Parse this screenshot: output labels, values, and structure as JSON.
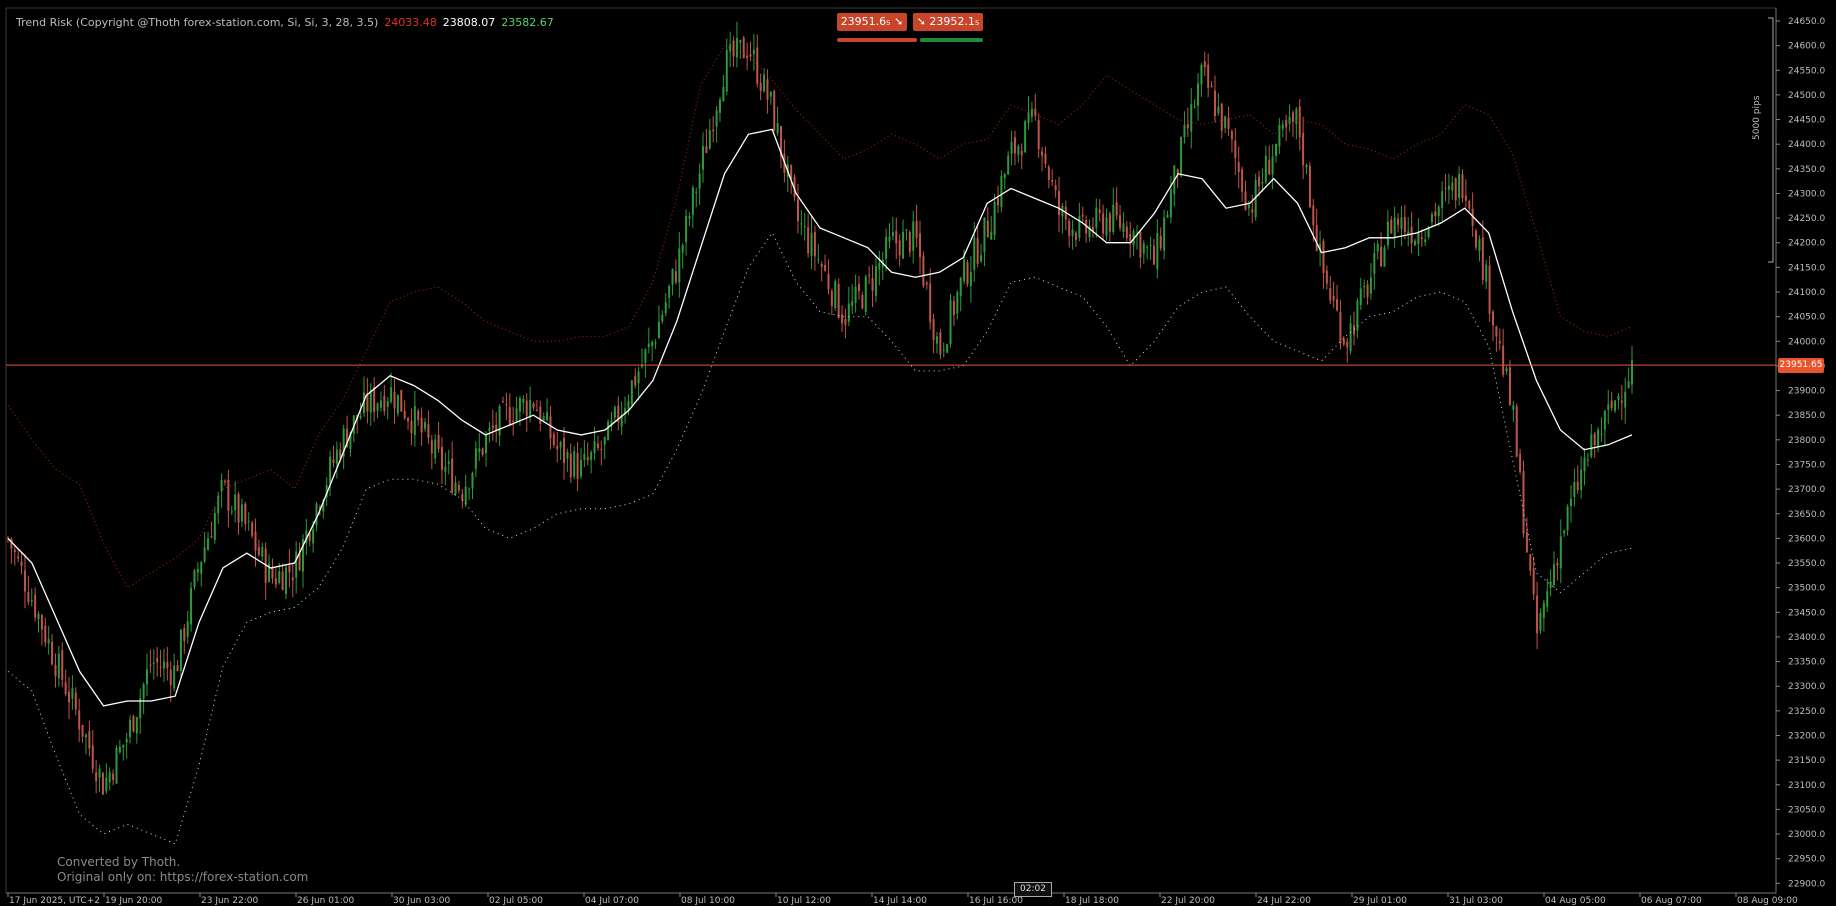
{
  "indicator": {
    "title": "Trend Risk (Copyright @Thoth forex-station.com, Si, Si, 3, 28, 3.5)",
    "value_upper": "24033.48",
    "value_mid": "23808.07",
    "value_lower": "23582.67"
  },
  "trade": {
    "sell_label": "23951.6₅  ➘",
    "buy_label": "➘  23952.1₅",
    "sell_color": "#c8452c",
    "buy_color": "#c8452c"
  },
  "watermark": {
    "line1": "Converted by Thoth.",
    "line2": "Original only on: https://forex-station.com"
  },
  "current_price_label": "23951.65",
  "pips_label": "5000 pips",
  "crosshair_time": "02:02",
  "colors": {
    "background": "#000000",
    "bull": "#2f9a3a",
    "bear": "#c0564a",
    "mid_line": "#ffffff",
    "upper_band": "#b02020",
    "lower_band": "#d8d8d8",
    "price_line": "#e8552c",
    "axis_text": "#bdbdbd"
  },
  "chart_data": {
    "type": "candlestick",
    "ylim": [
      22875,
      24690
    ],
    "current_price": 23951.65,
    "y_ticks": [
      "24650.0",
      "24600.0",
      "24550.0",
      "24500.0",
      "24450.0",
      "24400.0",
      "24350.0",
      "24300.0",
      "24250.0",
      "24200.0",
      "24150.0",
      "24100.0",
      "24050.0",
      "24000.0",
      "23950.0",
      "23900.0",
      "23850.0",
      "23800.0",
      "23750.0",
      "23700.0",
      "23650.0",
      "23600.0",
      "23550.0",
      "23500.0",
      "23450.0",
      "23400.0",
      "23350.0",
      "23300.0",
      "23250.0",
      "23200.0",
      "23150.0",
      "23100.0",
      "23050.0",
      "23000.0",
      "22950.0",
      "22900.0"
    ],
    "y_tick_values": [
      24650,
      24600,
      24550,
      24500,
      24450,
      24400,
      24350,
      24300,
      24250,
      24200,
      24150,
      24100,
      24050,
      24000,
      23950,
      23900,
      23850,
      23800,
      23750,
      23700,
      23650,
      23600,
      23550,
      23500,
      23450,
      23400,
      23350,
      23300,
      23250,
      23200,
      23150,
      23100,
      23050,
      23000,
      22950,
      22900
    ],
    "x_ticks": [
      "17 Jun 2025, UTC+2",
      "19 Jun 20:00",
      "23 Jun 22:00",
      "26 Jun 01:00",
      "30 Jun 03:00",
      "02 Jul 05:00",
      "04 Jul 07:00",
      "08 Jul 10:00",
      "10 Jul 12:00",
      "14 Jul 14:00",
      "16 Jul 16:00",
      "18 Jul 18:00",
      "22 Jul 20:00",
      "24 Jul 22:00",
      "29 Jul 01:00",
      "31 Jul 03:00",
      "04 Aug 05:00",
      "06 Aug 07:00",
      "08 Aug 09:00"
    ],
    "series": [
      {
        "name": "upper",
        "values": [
          23870,
          23800,
          23740,
          23710,
          23590,
          23500,
          23530,
          23560,
          23600,
          23700,
          23720,
          23740,
          23700,
          23810,
          23880,
          23980,
          24080,
          24100,
          24110,
          24080,
          24040,
          24020,
          24000,
          24000,
          24010,
          24010,
          24030,
          24120,
          24290,
          24520,
          24600,
          24580,
          24530,
          24470,
          24420,
          24370,
          24390,
          24420,
          24400,
          24370,
          24400,
          24410,
          24480,
          24460,
          24440,
          24480,
          24540,
          24510,
          24480,
          24450,
          24440,
          24450,
          24460,
          24420,
          24450,
          24440,
          24400,
          24390,
          24370,
          24400,
          24420,
          24480,
          24460,
          24380,
          24220,
          24050,
          24020,
          24010,
          24030
        ]
      },
      {
        "name": "trend",
        "values": [
          23600,
          23550,
          23440,
          23330,
          23260,
          23270,
          23270,
          23280,
          23430,
          23540,
          23570,
          23540,
          23550,
          23650,
          23770,
          23890,
          23930,
          23910,
          23880,
          23840,
          23810,
          23830,
          23850,
          23820,
          23810,
          23820,
          23860,
          23920,
          24040,
          24190,
          24340,
          24420,
          24430,
          24300,
          24230,
          24210,
          24190,
          24140,
          24130,
          24140,
          24170,
          24280,
          24310,
          24290,
          24270,
          24240,
          24200,
          24200,
          24260,
          24340,
          24330,
          24270,
          24280,
          24330,
          24280,
          24180,
          24190,
          24210,
          24210,
          24220,
          24240,
          24270,
          24220,
          24060,
          23920,
          23820,
          23780,
          23790,
          23810
        ]
      },
      {
        "name": "lower",
        "values": [
          23330,
          23290,
          23160,
          23040,
          23000,
          23020,
          23000,
          22980,
          23140,
          23340,
          23430,
          23450,
          23460,
          23500,
          23580,
          23700,
          23720,
          23720,
          23710,
          23680,
          23620,
          23600,
          23620,
          23650,
          23660,
          23660,
          23670,
          23690,
          23780,
          23890,
          24020,
          24150,
          24220,
          24120,
          24060,
          24050,
          24050,
          24000,
          23940,
          23940,
          23950,
          24020,
          24120,
          24130,
          24110,
          24090,
          24030,
          23950,
          24000,
          24070,
          24100,
          24110,
          24050,
          24000,
          23980,
          23960,
          24010,
          24050,
          24060,
          24090,
          24100,
          24080,
          23990,
          23760,
          23530,
          23490,
          23530,
          23570,
          23580
        ]
      },
      {
        "name": "close",
        "values": [
          23600,
          23480,
          23350,
          23230,
          23100,
          23200,
          23350,
          23330,
          23550,
          23700,
          23620,
          23520,
          23540,
          23680,
          23800,
          23870,
          23900,
          23840,
          23760,
          23700,
          23800,
          23860,
          23880,
          23780,
          23740,
          23790,
          23900,
          24000,
          24150,
          24350,
          24560,
          24600,
          24470,
          24250,
          24160,
          24050,
          24110,
          24200,
          24210,
          23980,
          24130,
          24230,
          24380,
          24450,
          24260,
          24220,
          24250,
          24230,
          24160,
          24360,
          24540,
          24430,
          24270,
          24390,
          24450,
          24150,
          24000,
          24120,
          24250,
          24220,
          24280,
          24330,
          24100,
          23850,
          23400,
          23600,
          23750,
          23850,
          23950
        ]
      }
    ]
  }
}
